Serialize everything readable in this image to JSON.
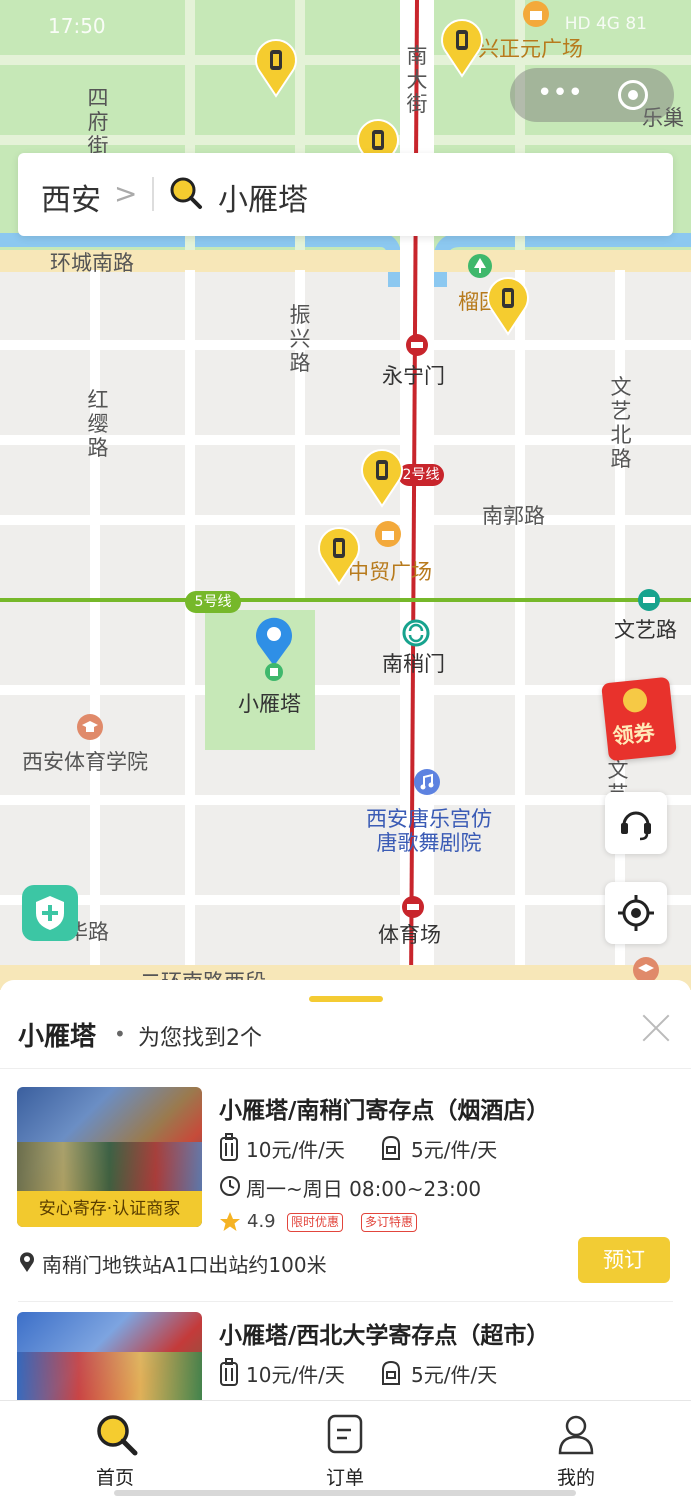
{
  "status_bar": {
    "time": "17:50",
    "right": "HD 4G 81"
  },
  "search": {
    "city": "西安",
    "chevron": ">",
    "query": "小雁塔"
  },
  "map": {
    "labels": {
      "street_sifujie": "四府街",
      "street_nandajie": "南大街",
      "place_xingzhengyuan": "兴正元广场",
      "place_lechao": "乐巢",
      "road_huancheng": "环城南路",
      "park_liuyuan": "榴园",
      "road_zhenxing": "振兴路",
      "station_yongningmen": "永宁门",
      "road_hongying": "红缨路",
      "road_wenyibei": "文艺北路",
      "metro_line2": "2号线",
      "road_nanguo": "南郭路",
      "place_zhongmao": "中贸广场",
      "metro_line5": "5号线",
      "station_wenyilu": "文艺路",
      "station_nanshaomen": "南稍门",
      "landmark_xiaoyanta": "小雁塔",
      "poi_xian_sport_univ": "西安体育学院",
      "poi_tangyuegong": "西安唐乐宫仿唐歌舞剧院",
      "station_tiyuchang": "体育场",
      "road_hanhua": "含华路",
      "road_erhuan": "二环南路西段",
      "road_wenyi_s": "文艺"
    },
    "colors": {
      "park": "#c6e8b7",
      "road": "#ffffff",
      "metro_red": "#c8252c",
      "metro_green": "#76b82a",
      "pin_yellow": "#f5cc2f",
      "location_blue": "#2f8fe6"
    }
  },
  "floating": {
    "coupon": "领券"
  },
  "sheet": {
    "title": "小雁塔",
    "dot": "•",
    "result_count": "为您找到2个",
    "stores": [
      {
        "name": "小雁塔/南稍门寄存点（烟酒店）",
        "badge": "安心寄存·认证商家",
        "price_large": "10元/件/天",
        "price_small": "5元/件/天",
        "hours": "周一~周日 08:00~23:00",
        "rating": "4.9",
        "tags": [
          "限时优惠",
          "多订特惠"
        ],
        "address": "南稍门地铁站A1口出站约100米",
        "book": "预订"
      },
      {
        "name": "小雁塔/西北大学寄存点（超市）",
        "price_large": "10元/件/天",
        "price_small": "5元/件/天"
      }
    ]
  },
  "tabs": [
    {
      "label": "首页",
      "icon": "search-icon"
    },
    {
      "label": "订单",
      "icon": "order-icon"
    },
    {
      "label": "我的",
      "icon": "profile-icon"
    }
  ]
}
